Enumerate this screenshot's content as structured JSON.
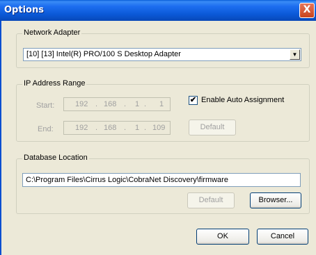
{
  "window": {
    "title": "Options",
    "close_label": "X"
  },
  "network_adapter": {
    "legend": "Network Adapter",
    "selected": "[10] [13] Intel(R) PRO/100 S Desktop Adapter",
    "dropdown_arrow": "▼"
  },
  "ip_range": {
    "legend": "IP Address Range",
    "start_label": "Start:",
    "end_label": "End:",
    "start": [
      "192",
      "168",
      "1",
      "1"
    ],
    "end": [
      "192",
      "168",
      "1",
      "109"
    ],
    "auto_assign_label": "Enable Auto Assignment",
    "auto_assign_checked": true,
    "check_mark": "✔",
    "default_label": "Default"
  },
  "database": {
    "legend": "Database Location",
    "path": "C:\\Program Files\\Cirrus Logic\\CobraNet Discovery\\firmware",
    "default_label": "Default",
    "browser_label": "Browser..."
  },
  "buttons": {
    "ok": "OK",
    "cancel": "Cancel"
  }
}
